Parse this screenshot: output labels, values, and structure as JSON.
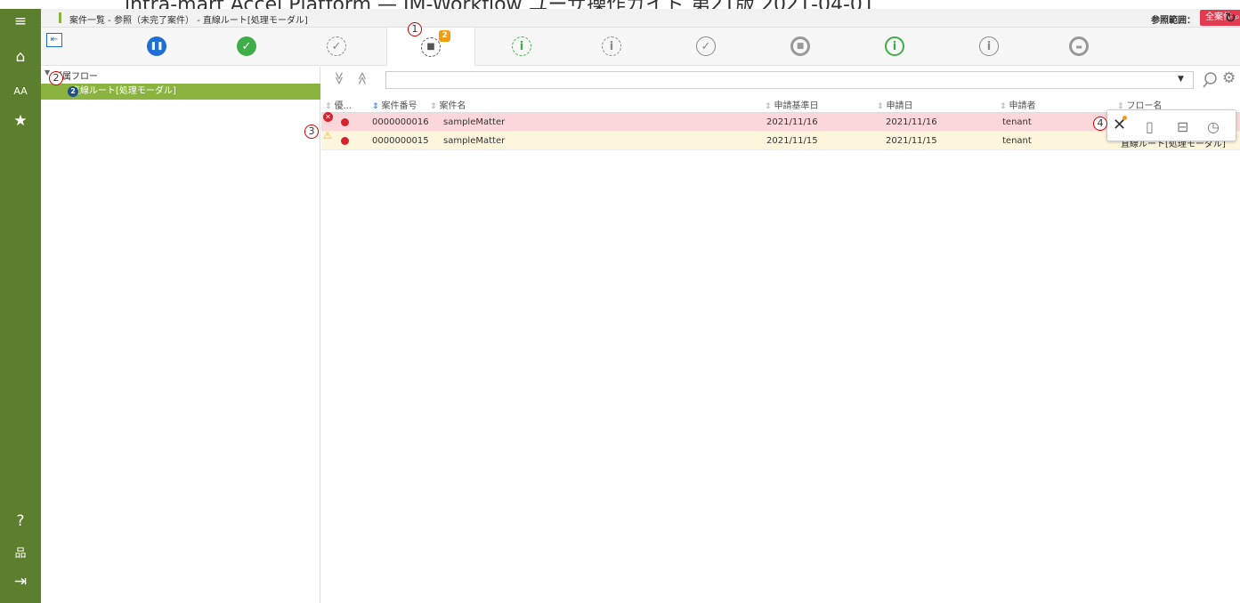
{
  "doc_header": {
    "text": "intra-mart Accel Platform — IM-Workflow ユーザ操作ガイド 第21版 2021-04-01"
  },
  "nav": {
    "items": [
      {
        "icon": "menu-icon",
        "glyph": "≡"
      },
      {
        "icon": "home-icon",
        "glyph": "⌂"
      },
      {
        "icon": "font-size-icon",
        "glyph": "AA"
      },
      {
        "icon": "favorite-star-icon",
        "glyph": "★"
      },
      {
        "icon": "help-icon",
        "glyph": "?"
      },
      {
        "icon": "sitemap-icon",
        "glyph": "品"
      },
      {
        "icon": "logout-icon",
        "glyph": "⇥"
      }
    ]
  },
  "titlebar": {
    "title": "案件一覧 - 参照（未完了案件） - 直線ルート[処理モーダル]",
    "scope_label": "参照範囲：",
    "scope_value": "全案件 ⌕",
    "refresh_icon": "refresh-icon"
  },
  "status_tabs": {
    "collapse_glyph": "⇤",
    "active_index": 3,
    "badge": "2",
    "tabs": [
      {
        "icon": "pause-icon",
        "style": "filled-blue",
        "glyph": "❚❚"
      },
      {
        "icon": "check-filled-icon",
        "style": "filled-green",
        "glyph": "✓"
      },
      {
        "icon": "check-dashed-icon",
        "style": "dashed-gray",
        "glyph": "✓"
      },
      {
        "icon": "stop-dashed-icon",
        "style": "dashed-dark",
        "glyph": "■"
      },
      {
        "icon": "info-dashed-green-icon",
        "style": "dashed-green",
        "glyph": "i"
      },
      {
        "icon": "info-dashed-gray-icon",
        "style": "dashed-gray",
        "glyph": "i"
      },
      {
        "icon": "check-outline-icon",
        "style": "solid-gray",
        "glyph": "✓"
      },
      {
        "icon": "stop-ring-icon",
        "style": "ring-gray",
        "glyph": "■"
      },
      {
        "icon": "info-green-icon",
        "style": "solid-green",
        "glyph": "i"
      },
      {
        "icon": "info-gray-icon",
        "style": "solid-gray",
        "glyph": "i"
      },
      {
        "icon": "folder-ring-icon",
        "style": "ring-gray",
        "glyph": "▬"
      }
    ]
  },
  "callouts": [
    "1",
    "2",
    "3",
    "4"
  ],
  "flow_panel": {
    "header": "所属フロー",
    "item_label": "直線ルート[処理モーダル]",
    "item_badge": "2"
  },
  "toolbar": {
    "expand_all_glyph": "≫",
    "collapse_all_glyph": "≪",
    "search_value": "",
    "search_icon": "search-icon",
    "settings_icon": "gear-icon"
  },
  "table": {
    "columns": [
      {
        "label": "優...",
        "sorted": false
      },
      {
        "label": "案件番号",
        "sorted": true
      },
      {
        "label": "案件名",
        "sorted": false
      },
      {
        "label": "申請基準日",
        "sorted": false
      },
      {
        "label": "申請日",
        "sorted": false
      },
      {
        "label": "申請者",
        "sorted": false
      },
      {
        "label": "フロー名",
        "sorted": false
      }
    ],
    "rows": [
      {
        "state": "error",
        "alert_icon": "error-icon",
        "number": "0000000016",
        "name": "sampleMatter",
        "base_date": "2021/11/16",
        "apply_date": "2021/11/16",
        "applicant": "tenant",
        "flow": ""
      },
      {
        "state": "warn",
        "alert_icon": "warning-icon",
        "number": "0000000015",
        "name": "sampleMatter",
        "base_date": "2021/11/15",
        "apply_date": "2021/11/15",
        "applicant": "tenant",
        "flow": "直線ルート[処理モーダル]"
      }
    ]
  },
  "action_popup": {
    "items": [
      {
        "icon": "tools-icon",
        "glyph": "✕"
      },
      {
        "icon": "document-icon",
        "glyph": "▯"
      },
      {
        "icon": "route-map-icon",
        "glyph": "⊟"
      },
      {
        "icon": "history-clock-icon",
        "glyph": "◷"
      }
    ]
  }
}
